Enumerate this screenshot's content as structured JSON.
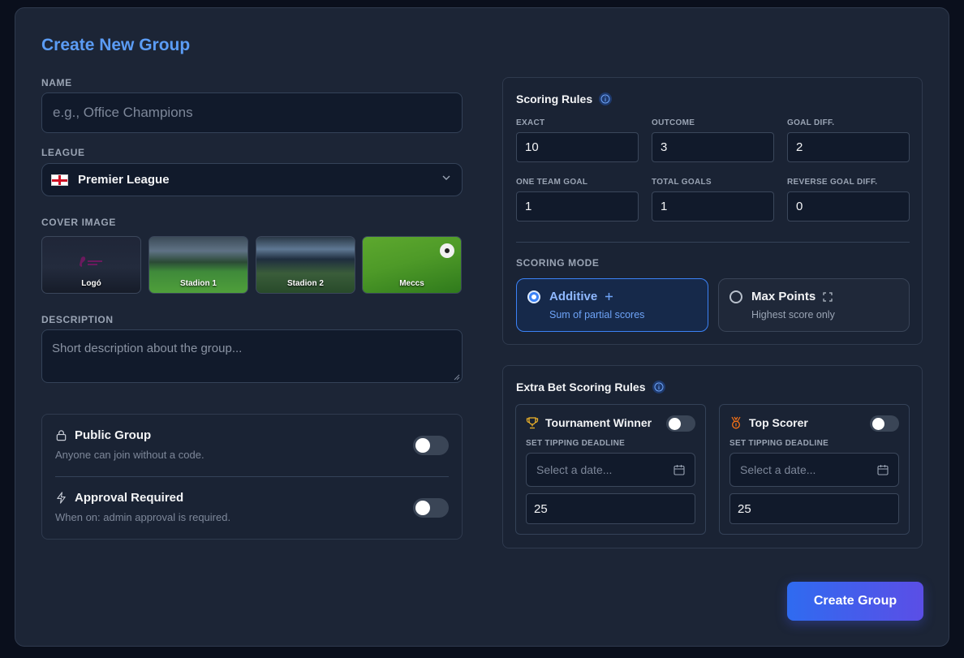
{
  "title": "Create New Group",
  "name": {
    "label": "NAME",
    "placeholder": "e.g., Office Champions"
  },
  "league": {
    "label": "LEAGUE",
    "selected": "Premier League",
    "flag": "england-flag"
  },
  "cover": {
    "label": "COVER IMAGE",
    "items": [
      {
        "caption": "Logó"
      },
      {
        "caption": "Stadion 1"
      },
      {
        "caption": "Stadion 2"
      },
      {
        "caption": "Meccs"
      }
    ]
  },
  "description": {
    "label": "DESCRIPTION",
    "placeholder": "Short description about the group..."
  },
  "privacy": {
    "public": {
      "title": "Public Group",
      "subtitle": "Anyone can join without a code.",
      "on": false
    },
    "approval": {
      "title": "Approval Required",
      "subtitle": "When on: admin approval is required.",
      "on": false
    }
  },
  "scoring": {
    "title": "Scoring Rules",
    "fields": [
      {
        "label": "EXACT",
        "value": "10"
      },
      {
        "label": "OUTCOME",
        "value": "3"
      },
      {
        "label": "GOAL DIFF.",
        "value": "2"
      },
      {
        "label": "ONE TEAM GOAL",
        "value": "1"
      },
      {
        "label": "TOTAL GOALS",
        "value": "1"
      },
      {
        "label": "REVERSE GOAL DIFF.",
        "value": "0"
      }
    ],
    "mode_label": "SCORING MODE",
    "modes": [
      {
        "title": "Additive",
        "subtitle": "Sum of partial scores",
        "selected": true
      },
      {
        "title": "Max Points",
        "subtitle": "Highest score only",
        "selected": false
      }
    ]
  },
  "extra": {
    "title": "Extra Bet Scoring Rules",
    "cards": [
      {
        "title": "Tournament Winner",
        "icon": "trophy-icon",
        "deadline_label": "SET TIPPING DEADLINE",
        "date_placeholder": "Select a date...",
        "points": "25",
        "on": false
      },
      {
        "title": "Top Scorer",
        "icon": "medal-icon",
        "deadline_label": "SET TIPPING DEADLINE",
        "date_placeholder": "Select a date...",
        "points": "25",
        "on": false
      }
    ]
  },
  "create_button": "Create Group",
  "colors": {
    "accent": "#5b9cf5",
    "primary": "#3b82f6",
    "background": "#1c2536"
  }
}
